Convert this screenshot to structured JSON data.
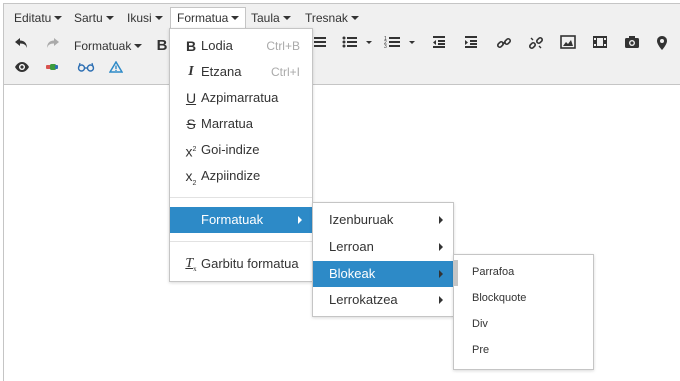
{
  "menubar": {
    "items": [
      "Editatu",
      "Sartu",
      "Ikusi",
      "Formatua",
      "Taula",
      "Tresnak"
    ]
  },
  "toolbar": {
    "formats_label": "Formatuak",
    "bold_glyph": "B"
  },
  "format_menu": {
    "items": [
      {
        "label": "Lodia",
        "shortcut": "Ctrl+B",
        "icon": "bold-icon"
      },
      {
        "label": "Etzana",
        "shortcut": "Ctrl+I",
        "icon": "italic-icon"
      },
      {
        "label": "Azpimarratua",
        "shortcut": "",
        "icon": "underline-icon"
      },
      {
        "label": "Marratua",
        "shortcut": "",
        "icon": "strikethrough-icon"
      },
      {
        "label": "Goi-indize",
        "shortcut": "",
        "icon": "superscript-icon"
      },
      {
        "label": "Azpiindize",
        "shortcut": "",
        "icon": "subscript-icon"
      },
      {
        "label": "Formatuak",
        "shortcut": "",
        "icon": ""
      },
      {
        "label": "Garbitu formatua",
        "shortcut": "",
        "icon": "clear-formatting-icon"
      }
    ]
  },
  "formats_submenu": {
    "items": [
      "Izenburuak",
      "Lerroan",
      "Blokeak",
      "Lerrokatzea"
    ]
  },
  "blocks_submenu": {
    "items": [
      "Parrafoa",
      "Blockquote",
      "Div",
      "Pre"
    ]
  },
  "colors": {
    "highlight": "#2d8ac7",
    "toolbar_bg": "#f0f0f0"
  }
}
